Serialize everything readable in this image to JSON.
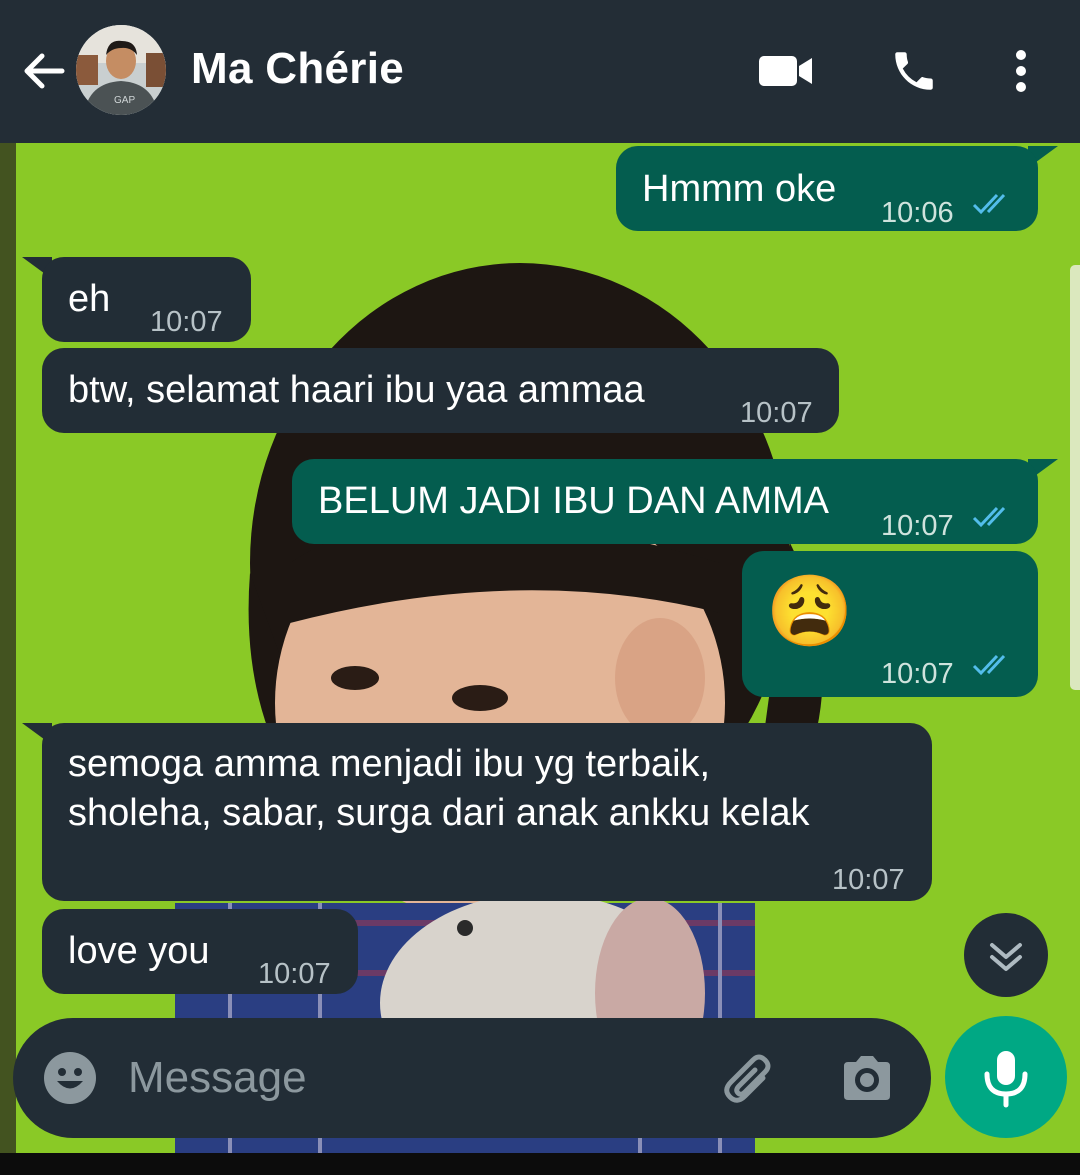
{
  "header": {
    "contact_name": "Ma Chérie",
    "icons": [
      "back-arrow-icon",
      "avatar",
      "video-call-icon",
      "phone-icon",
      "more-vert-icon"
    ]
  },
  "messages": [
    {
      "direction": "outgoing",
      "text": "Hmmm oke",
      "time": "10:06",
      "status": "read"
    },
    {
      "direction": "incoming",
      "text": "eh",
      "time": "10:07"
    },
    {
      "direction": "incoming",
      "text": "btw, selamat haari ibu yaa ammaa",
      "time": "10:07"
    },
    {
      "direction": "outgoing",
      "text": "BELUM JADI IBU DAN AMMA",
      "time": "10:07",
      "status": "read"
    },
    {
      "direction": "outgoing",
      "text": "😩",
      "time": "10:07",
      "status": "read"
    },
    {
      "direction": "incoming",
      "text_lines": [
        "semoga amma menjadi ibu yg terbaik,",
        "sholeha, sabar, surga dari anak ankku kelak"
      ],
      "time": "10:07"
    },
    {
      "direction": "incoming",
      "text": "love you",
      "time": "10:07"
    }
  ],
  "composer": {
    "placeholder": "Message",
    "icons": [
      "emoji-icon",
      "attach-icon",
      "camera-icon",
      "mic-icon"
    ]
  },
  "colors": {
    "header_bg": "#232d36",
    "incoming_bubble": "#222d36",
    "outgoing_bubble": "#045d4f",
    "read_tick": "#53bdeb",
    "mic_button": "#00a884",
    "wallpaper_green": "#8ac926"
  }
}
